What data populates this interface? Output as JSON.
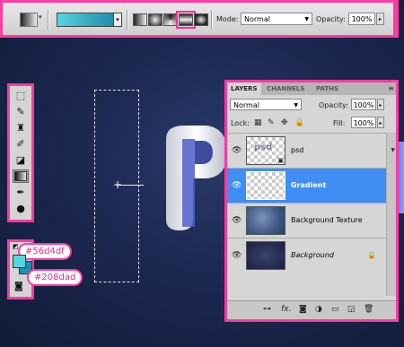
{
  "options_bar": {
    "mode_label": "Mode:",
    "mode_value": "Normal",
    "opacity_label": "Opacity:",
    "opacity_value": "100%",
    "gradient_colors": [
      "#56d4df",
      "#208dad"
    ],
    "gradient_types": [
      "linear-gradient",
      "radial-gradient",
      "angle-gradient",
      "reflected-gradient",
      "diamond-gradient"
    ],
    "active_gradient_type": "reflected-gradient"
  },
  "tools": {
    "items": [
      "marquee-tool",
      "brush-tool",
      "clone-stamp-tool",
      "history-brush-tool",
      "eraser-tool",
      "gradient-tool",
      "pen-tool",
      "zoom-tool"
    ],
    "active": "gradient-tool"
  },
  "colors": {
    "foreground": "#56d4df",
    "background": "#208dad",
    "foreground_label": "#56d4df",
    "background_label": "#208dad"
  },
  "layers_panel": {
    "tabs": [
      "LAYERS",
      "CHANNELS",
      "PATHS"
    ],
    "active_tab": "LAYERS",
    "blend_mode": "Normal",
    "opacity_label": "Opacity:",
    "opacity_value": "100%",
    "lock_label": "Lock:",
    "fill_label": "Fill:",
    "fill_value": "100%",
    "layers": [
      {
        "name": "psd",
        "selected": false
      },
      {
        "name": "Gradient",
        "selected": true
      },
      {
        "name": "Background Texture",
        "selected": false
      },
      {
        "name": "Background",
        "selected": false,
        "locked": true
      }
    ],
    "footer_icons": [
      "link-icon",
      "fx-icon",
      "mask-icon",
      "adjustment-icon",
      "group-icon",
      "new-layer-icon",
      "trash-icon"
    ]
  },
  "accent_color": "#ff3aa0",
  "selection_color": "#3e8ef4"
}
